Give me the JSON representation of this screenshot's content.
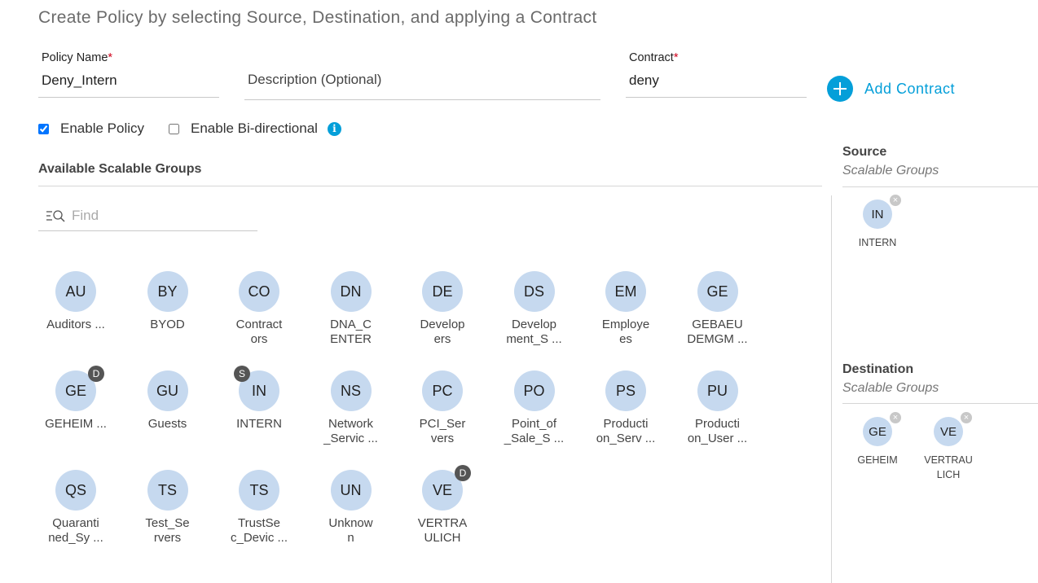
{
  "page": {
    "title": "Create Policy by selecting Source, Destination, and applying a Contract"
  },
  "form": {
    "policy_name": {
      "label": "Policy Name",
      "required_mark": "*",
      "value": "Deny_Intern"
    },
    "description": {
      "placeholder": "Description (Optional)",
      "value": ""
    },
    "contract": {
      "label": "Contract",
      "required_mark": "*",
      "value": "deny"
    },
    "add_contract_label": "Add Contract",
    "enable_policy": {
      "label": "Enable Policy",
      "checked": true
    },
    "enable_bidirectional": {
      "label": "Enable Bi-directional",
      "checked": false
    },
    "info_icon_glyph": "i"
  },
  "available": {
    "heading": "Available Scalable Groups",
    "find_placeholder": "Find",
    "groups": [
      {
        "abbr": "AU",
        "name": "Auditors ...",
        "badge": ""
      },
      {
        "abbr": "BY",
        "name": "BYOD",
        "badge": ""
      },
      {
        "abbr": "CO",
        "name": "Contract\nors",
        "badge": ""
      },
      {
        "abbr": "DN",
        "name": "DNA_C\nENTER",
        "badge": ""
      },
      {
        "abbr": "DE",
        "name": "Develop\ners",
        "badge": ""
      },
      {
        "abbr": "DS",
        "name": "Develop\nment_S ...",
        "badge": ""
      },
      {
        "abbr": "EM",
        "name": "Employe\nes",
        "badge": ""
      },
      {
        "abbr": "GE",
        "name": "GEBAEU\nDEMGM ...",
        "badge": ""
      },
      {
        "abbr": "GE",
        "name": "GEHEIM ...",
        "badge": "D"
      },
      {
        "abbr": "GU",
        "name": "Guests",
        "badge": ""
      },
      {
        "abbr": "IN",
        "name": "INTERN",
        "badge": "S"
      },
      {
        "abbr": "NS",
        "name": "Network\n_Servic ...",
        "badge": ""
      },
      {
        "abbr": "PC",
        "name": "PCI_Ser\nvers",
        "badge": ""
      },
      {
        "abbr": "PO",
        "name": "Point_of\n_Sale_S ...",
        "badge": ""
      },
      {
        "abbr": "PS",
        "name": "Producti\non_Serv ...",
        "badge": ""
      },
      {
        "abbr": "PU",
        "name": "Producti\non_User ...",
        "badge": ""
      },
      {
        "abbr": "QS",
        "name": "Quaranti\nned_Sy ...",
        "badge": ""
      },
      {
        "abbr": "TS",
        "name": "Test_Se\nrvers",
        "badge": ""
      },
      {
        "abbr": "TS",
        "name": "TrustSe\nc_Devic ...",
        "badge": ""
      },
      {
        "abbr": "UN",
        "name": "Unknow\nn",
        "badge": ""
      },
      {
        "abbr": "VE",
        "name": "VERTRA\nULICH",
        "badge": "D"
      }
    ]
  },
  "source": {
    "title": "Source",
    "subtitle": "Scalable Groups",
    "selected": [
      {
        "abbr": "IN",
        "name": "INTERN"
      }
    ]
  },
  "destination": {
    "title": "Destination",
    "subtitle": "Scalable Groups",
    "selected": [
      {
        "abbr": "GE",
        "name": "GEHEIM"
      },
      {
        "abbr": "VE",
        "name": "VERTRAU\nLICH"
      }
    ]
  },
  "colors": {
    "accent": "#049fd9",
    "avatar_bg": "#c6d9ef",
    "badge_bg": "#555555",
    "required": "#d0021b"
  }
}
